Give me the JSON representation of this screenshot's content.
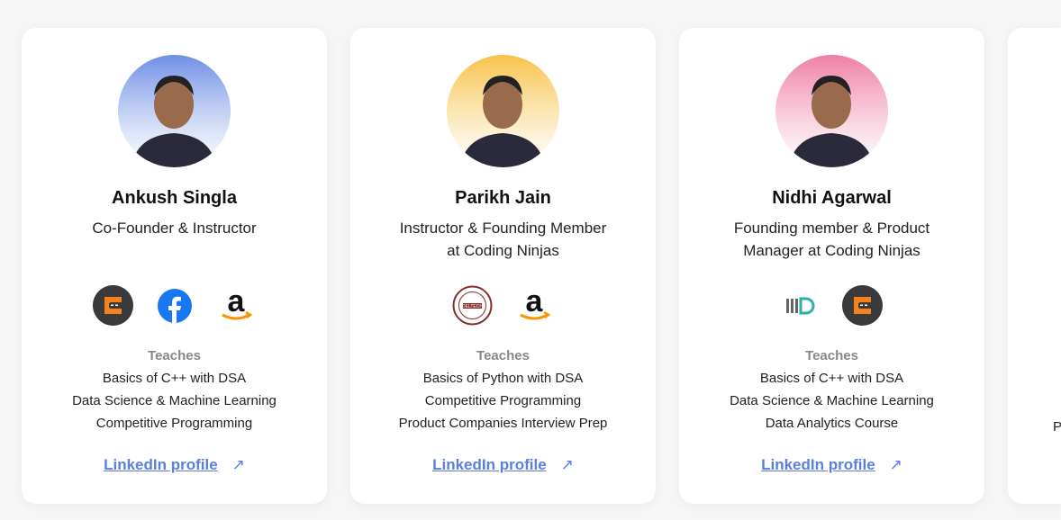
{
  "cards": [
    {
      "name": "Ankush Singla",
      "role": "Co-Founder & Instructor",
      "logos": [
        "coding-ninjas-logo",
        "facebook-logo",
        "amazon-logo"
      ],
      "teaches_label": "Teaches",
      "courses": [
        "Basics of C++ with DSA",
        "Data Science & Machine Learning",
        "Competitive Programming"
      ],
      "link": "LinkedIn profile",
      "avatar_bg": "#6f8fe6"
    },
    {
      "name": "Parikh Jain",
      "role": "Instructor & Founding Member at Coding Ninjas",
      "logos": [
        "deltech-logo",
        "amazon-logo"
      ],
      "teaches_label": "Teaches",
      "courses": [
        "Basics of Python with DSA",
        "Competitive Programming",
        "Product Companies Interview Prep"
      ],
      "link": "LinkedIn profile",
      "avatar_bg": "#f7c24a"
    },
    {
      "name": "Nidhi Agarwal",
      "role": "Founding member & Product Manager at Coding Ninjas",
      "logos": [
        "iiitd-logo",
        "coding-ninjas-logo"
      ],
      "teaches_label": "Teaches",
      "courses": [
        "Basics of C++ with DSA",
        "Data Science & Machine Learning",
        "Data Analytics Course"
      ],
      "link": "LinkedIn profile",
      "avatar_bg": "#ef7fa4"
    }
  ],
  "partial_card": {
    "course_fragment": "P"
  },
  "arrow_icon": "↗"
}
